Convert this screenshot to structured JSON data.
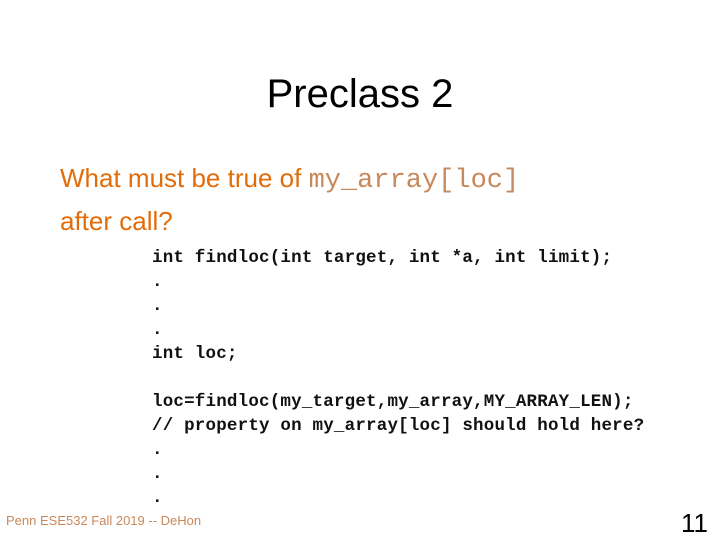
{
  "slide": {
    "title": "Preclass 2",
    "question": {
      "prefix": "What must be true of ",
      "code": "my_array[loc]",
      "suffix": "after call?"
    },
    "code_lines": [
      "int findloc(int target, int *a, int limit);",
      ".",
      ".",
      ".",
      "int loc;",
      "",
      "loc=findloc(my_target,my_array,MY_ARRAY_LEN);",
      "// property on my_array[loc] should hold here?",
      ".",
      ".",
      "."
    ],
    "footer": "Penn ESE532 Fall 2019 -- DeHon",
    "page_number": "11"
  }
}
